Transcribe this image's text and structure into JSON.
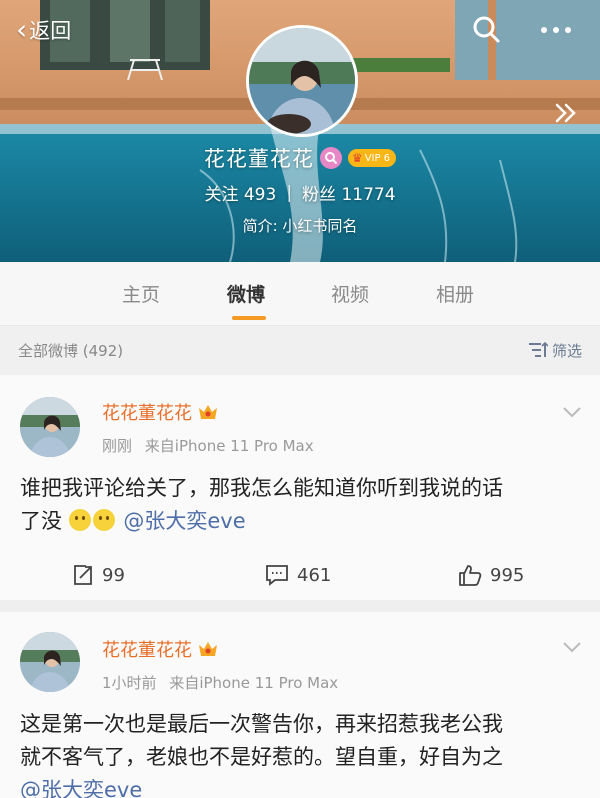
{
  "nav": {
    "back_label": "返回"
  },
  "profile": {
    "name": "花花董花花",
    "vip_label": "VIP 6",
    "follow_label": "关注",
    "follow_count": "493",
    "stat_separator": "|",
    "fans_label": "粉丝",
    "fans_count": "11774",
    "bio": "简介: 小红书同名"
  },
  "tabs": [
    "主页",
    "微博",
    "视频",
    "相册"
  ],
  "active_tab": "微博",
  "filter": {
    "title": "全部微博 (492)",
    "button_label": "筛选"
  },
  "posts": [
    {
      "author": "花花董花花",
      "time": "刚刚",
      "source": "来自iPhone 11 Pro Max",
      "text_line1": "谁把我评论给关了，那我怎么能知道你听到我说的话",
      "text_line2": "了没",
      "mention": "@张大奕eve",
      "reposts": "99",
      "comments": "461",
      "likes": "995"
    },
    {
      "author": "花花董花花",
      "time": "1小时前",
      "source": "来自iPhone 11 Pro Max",
      "text_line1": "这是第一次也是最后一次警告你，再来招惹我老公我",
      "text_line2": "就不客气了，老娘也不是好惹的。望自重，好自为之",
      "mention": "@张大奕eve"
    }
  ],
  "colors": {
    "accent_orange": "#f59a23",
    "author_orange": "#e8702a",
    "mention_blue": "#4e6ea9",
    "pool_blue": "#1f7f9b"
  }
}
